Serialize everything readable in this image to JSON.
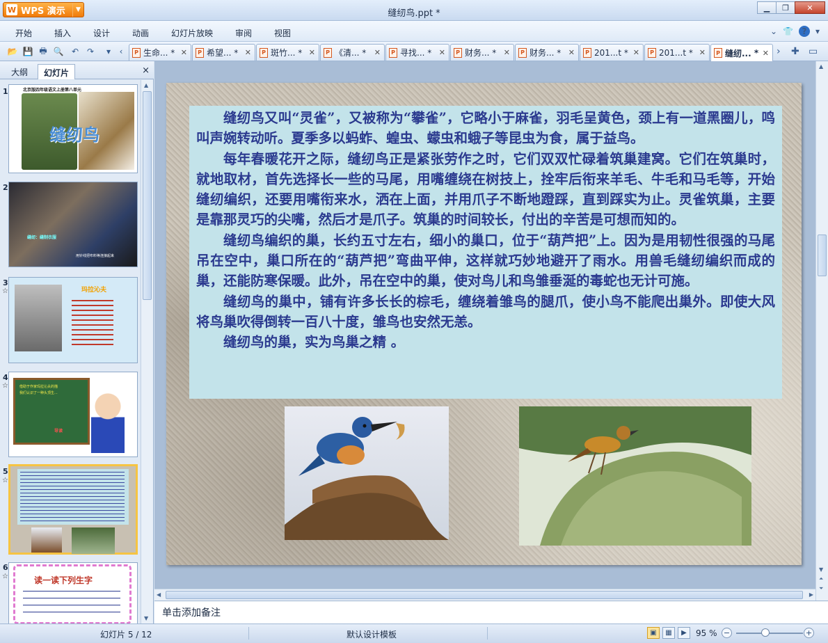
{
  "app": {
    "name": "WPS 演示",
    "window_title": "缝纫鸟.ppt *"
  },
  "menu": [
    "开始",
    "插入",
    "设计",
    "动画",
    "幻灯片放映",
    "审阅",
    "视图"
  ],
  "tabs": [
    {
      "label": "生命...",
      "modified": "*"
    },
    {
      "label": "希望...",
      "modified": "*"
    },
    {
      "label": "斑竹...",
      "modified": "*"
    },
    {
      "label": "《清...",
      "modified": "*"
    },
    {
      "label": "寻找...",
      "modified": "*"
    },
    {
      "label": "财务...",
      "modified": "*"
    },
    {
      "label": "财务...",
      "modified": "*"
    },
    {
      "label": "201...t",
      "modified": "*"
    },
    {
      "label": "201...t",
      "modified": "*"
    },
    {
      "label": "缝纫...",
      "modified": "*"
    }
  ],
  "left_panel": {
    "tab_outline": "大纲",
    "tab_slides": "幻灯片",
    "close": "×"
  },
  "thumbnails": [
    {
      "num": "1",
      "header": "北京版四年级语文上册第八单元",
      "title": "缝纫鸟"
    },
    {
      "num": "2",
      "caption": "缝纫：缝制衣服",
      "caption2": "用针线把布料等连接起来"
    },
    {
      "num": "3",
      "title": "玛拉沁夫"
    },
    {
      "num": "4",
      "line1": "借助于作家玛拉沁夫的描",
      "line2": "我们认识了一种头顶生...",
      "note": "导读"
    },
    {
      "num": "5"
    },
    {
      "num": "6",
      "title": "读一读下列生字"
    }
  ],
  "slide": {
    "paragraphs": [
      "缝纫鸟又叫“灵雀”，又被称为“攀雀”，它略小于麻雀，羽毛呈黄色，颈上有一道黑圈儿，鸣叫声婉转动听。夏季多以蚂蚱、蝗虫、蠓虫和蛾子等昆虫为食，属于益鸟。",
      "每年春暖花开之际，缝纫鸟正是紧张劳作之时，它们双双忙碌着筑巢建窝。它们在筑巢时，就地取材，首先选择长一些的马尾，用嘴缠绕在树技上，拴牢后衔来羊毛、牛毛和马毛等，开始缝纫编织，还要用嘴衔来水，洒在上面，并用爪子不断地蹬踩，直到踩实为止。灵雀筑巢，主要是靠那灵巧的尖嘴，然后才是爪子。筑巢的时间较长，付出的辛苦是可想而知的。",
      "缝纫鸟编织的巢，长约五寸左右，细小的巢口，位于“葫芦把”上。因为是用韧性很强的马尾吊在空中，巢口所在的“葫芦把”弯曲平伸，这样就巧妙地避开了雨水。用兽毛缝纫编织而成的巢，还能防寒保暖。此外，吊在空中的巢，使对鸟儿和鸟雏垂涎的毒蛇也无计可施。",
      "缝纫鸟的巢中，铺有许多长长的棕毛，缠绕着雏鸟的腿爪，使小鸟不能爬出巢外。即使大风将鸟巢吹得倒转一百八十度，雏鸟也安然无恙。",
      "缝纫鸟的巢，实为鸟巢之精 。"
    ]
  },
  "notes_placeholder": "单击添加备注",
  "status": {
    "slide_indicator": "幻灯片 5 / 12",
    "template": "默认设计模板",
    "zoom": "95 %"
  },
  "colors": {
    "text_blue": "#2b3a8f",
    "textbox_bg": "#c3e3ea",
    "app_orange": "#f07b0a",
    "selected_thumb_border": "#f6c443"
  }
}
